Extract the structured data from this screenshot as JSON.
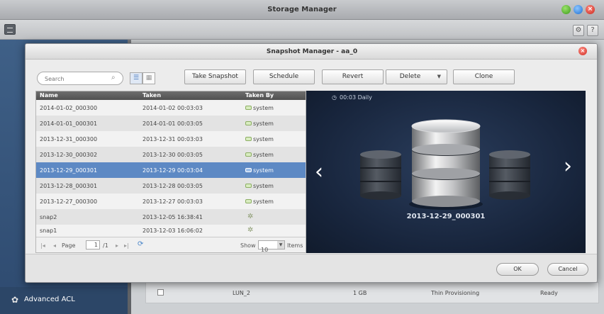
{
  "app": {
    "title": "Storage Manager",
    "sidebar_item": "Advanced ACL",
    "background_row": {
      "name": "LUN_2",
      "size": "1 GB",
      "type": "Thin Provisioning",
      "status": "Ready"
    }
  },
  "modal": {
    "title": "Snapshot Manager - aa_0",
    "search_placeholder": "Search",
    "buttons": {
      "take_snapshot": "Take Snapshot",
      "schedule": "Schedule",
      "revert": "Revert",
      "delete": "Delete",
      "clone": "Clone",
      "ok": "OK",
      "cancel": "Cancel"
    },
    "columns": [
      "Name",
      "Taken",
      "Taken By"
    ],
    "rows": [
      {
        "name": "2014-01-02_000300",
        "taken": "2014-01-02 00:03:03",
        "by": "system"
      },
      {
        "name": "2014-01-01_000301",
        "taken": "2014-01-01 00:03:05",
        "by": "system"
      },
      {
        "name": "2013-12-31_000300",
        "taken": "2013-12-31 00:03:03",
        "by": "system"
      },
      {
        "name": "2013-12-30_000302",
        "taken": "2013-12-30 00:03:05",
        "by": "system"
      },
      {
        "name": "2013-12-29_000301",
        "taken": "2013-12-29 00:03:04",
        "by": "system"
      },
      {
        "name": "2013-12-28_000301",
        "taken": "2013-12-28 00:03:05",
        "by": "system"
      },
      {
        "name": "2013-12-27_000300",
        "taken": "2013-12-27 00:03:03",
        "by": "system"
      },
      {
        "name": "snap2",
        "taken": "2013-12-05 16:38:41",
        "by": ""
      },
      {
        "name": "snap1",
        "taken": "2013-12-03 16:06:02",
        "by": ""
      }
    ],
    "pager": {
      "page_label": "Page",
      "page_value": "1",
      "page_total": "/1",
      "show_label": "Show",
      "show_value": "10",
      "items_label": "Items"
    },
    "preview": {
      "schedule": "00:03 Daily",
      "selected_label": "2013-12-29_000301"
    }
  },
  "colors": {
    "selected_row": "#5d89c4",
    "preview_bg": "#17243b",
    "close_red": "#cf2b20"
  }
}
